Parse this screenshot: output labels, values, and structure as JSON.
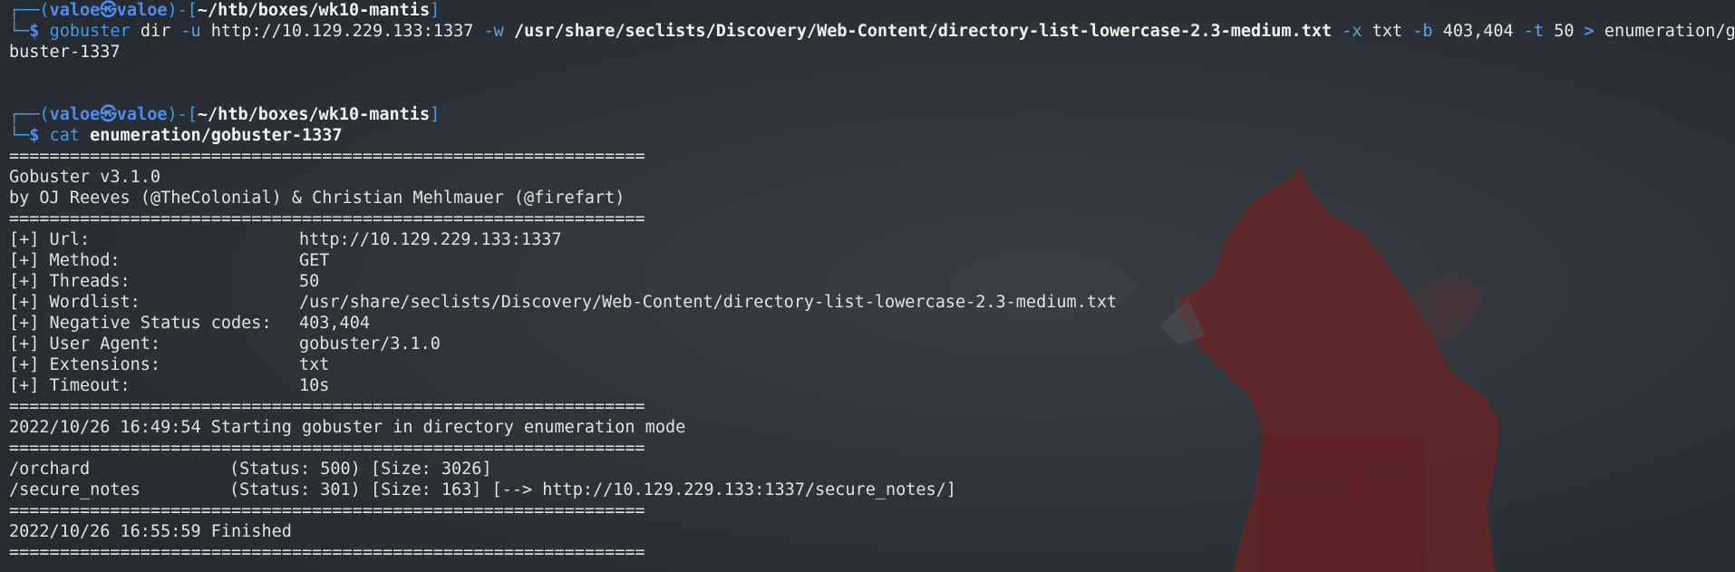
{
  "prompt1": {
    "user": "valoe",
    "host": "valoe",
    "cwd": "~/htb/boxes/wk10-mantis",
    "command": "gobuster",
    "parts": {
      "sub": "dir",
      "u_flag": "-u",
      "u_val": "http://10.129.229.133:1337",
      "w_flag": "-w",
      "w_val": "/usr/share/seclists/Discovery/Web-Content/directory-list-lowercase-2.3-medium.txt",
      "x_flag": "-x",
      "x_val": "txt",
      "b_flag": "-b",
      "b_val": "403,404",
      "t_flag": "-t",
      "t_val": "50",
      "redir": ">",
      "out_head": "enumeration/go",
      "out_tail": "buster-1337"
    }
  },
  "prompt2": {
    "user": "valoe",
    "host": "valoe",
    "cwd": "~/htb/boxes/wk10-mantis",
    "command": "cat",
    "arg": "enumeration/gobuster-1337"
  },
  "output": {
    "sep": "===============================================================",
    "version": "Gobuster v3.1.0",
    "authors": "by OJ Reeves (@TheColonial) & Christian Mehlmauer (@firefart)",
    "config": [
      {
        "key": "[+] Url:",
        "value": "http://10.129.229.133:1337"
      },
      {
        "key": "[+] Method:",
        "value": "GET"
      },
      {
        "key": "[+] Threads:",
        "value": "50"
      },
      {
        "key": "[+] Wordlist:",
        "value": "/usr/share/seclists/Discovery/Web-Content/directory-list-lowercase-2.3-medium.txt"
      },
      {
        "key": "[+] Negative Status codes:",
        "value": "403,404"
      },
      {
        "key": "[+] User Agent:",
        "value": "gobuster/3.1.0"
      },
      {
        "key": "[+] Extensions:",
        "value": "txt"
      },
      {
        "key": "[+] Timeout:",
        "value": "10s"
      }
    ],
    "start": "2022/10/26 16:49:54 Starting gobuster in directory enumeration mode",
    "findings": [
      {
        "path": "/orchard",
        "info": "(Status: 500) [Size: 3026]"
      },
      {
        "path": "/secure_notes",
        "info": "(Status: 301) [Size: 163] [--> http://10.129.229.133:1337/secure_notes/]"
      }
    ],
    "finish": "2022/10/26 16:55:59 Finished"
  },
  "theme": {
    "background": "#2b3038",
    "prompt_blue": "#4e8cf0",
    "command_blue": "#3d9be9",
    "fox_red": "#8a2c2c"
  }
}
